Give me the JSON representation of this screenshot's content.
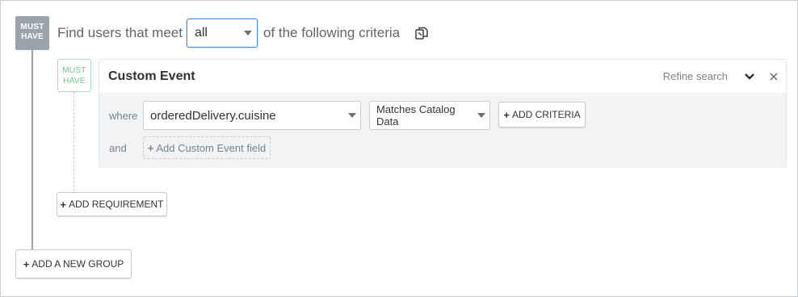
{
  "group": {
    "badge_line1": "MUST",
    "badge_line2": "HAVE",
    "intro_text": "Find users that meet",
    "match_select_value": "all",
    "suffix_text": "of the following criteria"
  },
  "requirement": {
    "badge_line1": "MUST",
    "badge_line2": "HAVE",
    "title": "Custom Event",
    "refine_label": "Refine search",
    "where_label": "where",
    "field_value": "orderedDelivery.cuisine",
    "operator_value": "Matches Catalog Data",
    "add_criteria_label": "ADD CRITERIA",
    "and_label": "and",
    "add_field_label": "Add Custom Event field"
  },
  "actions": {
    "add_requirement_label": "ADD REQUIREMENT",
    "add_group_label": "ADD A NEW GROUP"
  },
  "icons": {
    "copy": "copy-icon",
    "chevron": "chevron-down-icon",
    "close": "close-icon",
    "plus": "plus-icon"
  },
  "colors": {
    "accent_blue": "#4a90e2",
    "must_have_gray": "#9aa3ab",
    "must_have_green": "#7ac792"
  }
}
